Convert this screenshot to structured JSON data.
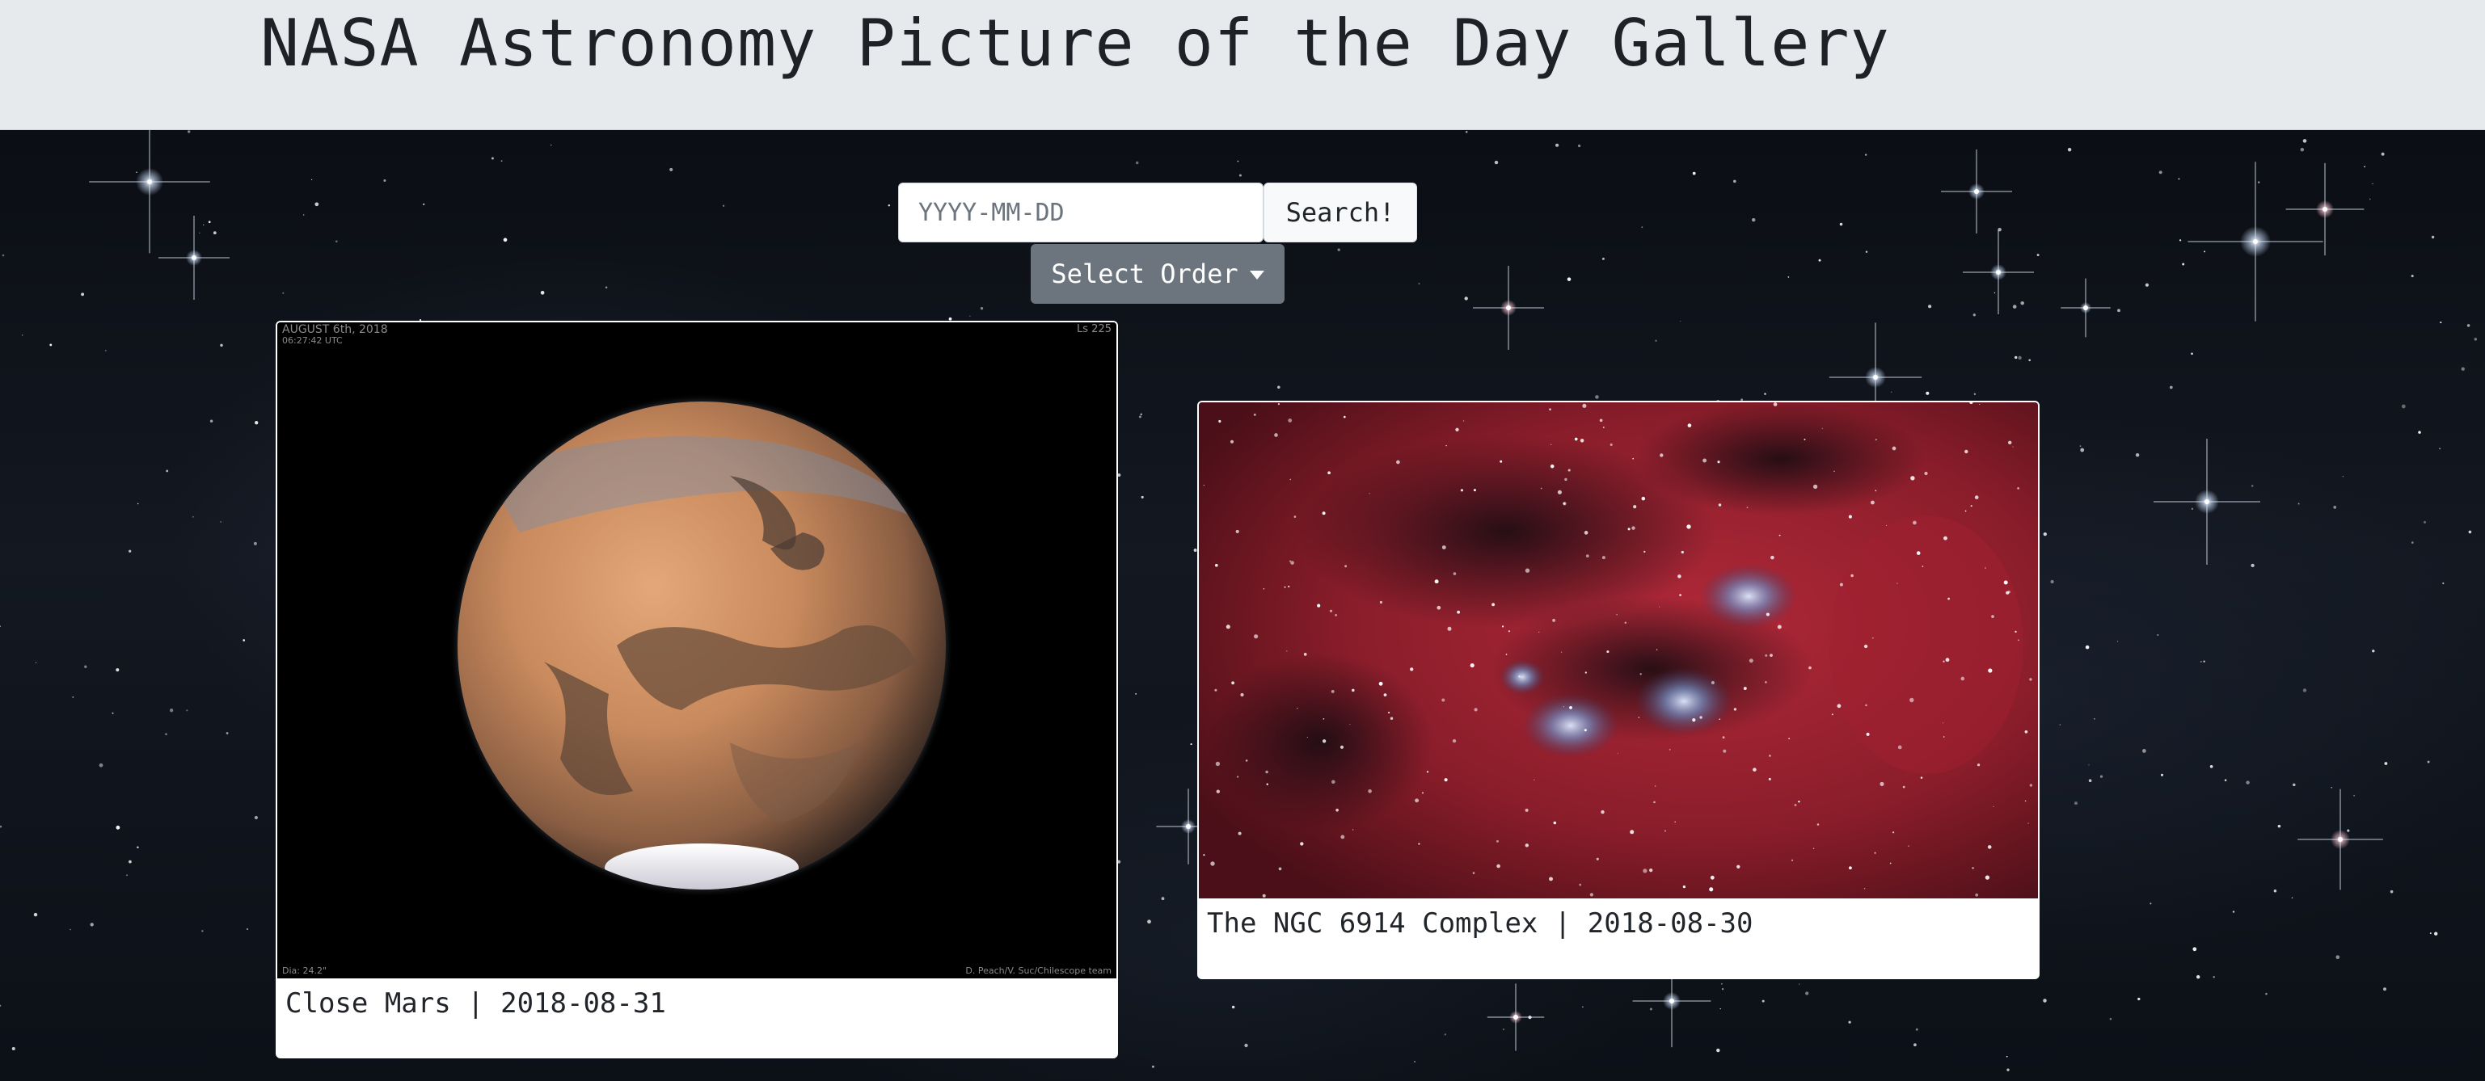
{
  "header": {
    "title": "NASA Astronomy Picture of the Day Gallery"
  },
  "search": {
    "placeholder": "YYYY-MM-DD",
    "value": "",
    "button_label": "Search!"
  },
  "order": {
    "label": "Select Order",
    "icon": "caret-down-icon"
  },
  "gallery": [
    {
      "title": "Close Mars",
      "date": "2018-08-31",
      "caption": "Close Mars | 2018-08-31",
      "image_overlay": {
        "top_left": "AUGUST 6th, 2018",
        "time": "06:27:42 UTC",
        "top_right": "Ls 225",
        "bottom_left": "Dia: 24.2\"",
        "bottom_right": "D. Peach/V. Suc/Chilescope team"
      }
    },
    {
      "title": "The NGC 6914 Complex",
      "date": "2018-08-30",
      "caption": "The NGC 6914 Complex | 2018-08-30"
    }
  ],
  "colors": {
    "header_bg": "#e7eaed",
    "order_button": "#6c757d",
    "card_bg": "#ffffff"
  }
}
